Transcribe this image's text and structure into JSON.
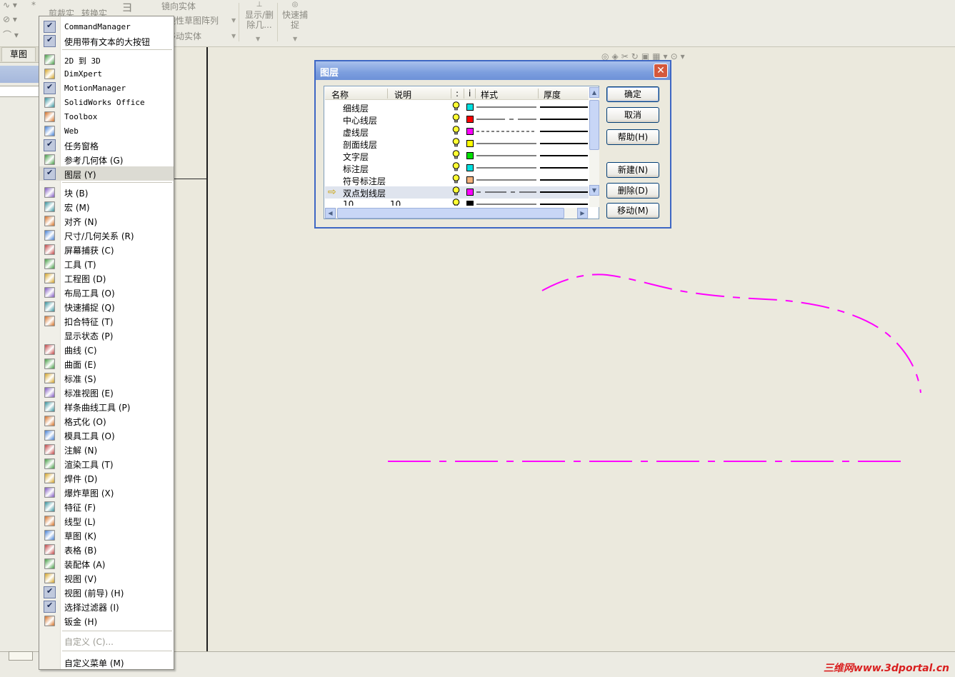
{
  "toolbar": {
    "trim": "剪裁实",
    "convert": "转换实",
    "mirror": "镜向实体",
    "linear_pattern": "线性草图阵列",
    "move": "移动实体",
    "show_delete_line1": "显示/删",
    "show_delete_line2": "除几...",
    "quick_snap_line1": "快速捕",
    "quick_snap_line2": "捉",
    "sketch_tab": "草图"
  },
  "context_menu": {
    "items": [
      {
        "label": "CommandManager",
        "checked": true,
        "mono": true
      },
      {
        "label": "使用带有文本的大按钮",
        "checked": true
      },
      {
        "label": "2D 到 3D",
        "icon": "2d-to-3d-icon",
        "mono": true
      },
      {
        "label": "DimXpert",
        "icon": "dimxpert-icon",
        "mono": true
      },
      {
        "label": "MotionManager",
        "checked": true,
        "mono": true
      },
      {
        "label": "SolidWorks Office",
        "icon": "solidworks-office-icon",
        "mono": true
      },
      {
        "label": "Toolbox",
        "icon": "toolbox-icon",
        "mono": true
      },
      {
        "label": "Web",
        "icon": "web-globe-icon",
        "mono": true
      },
      {
        "label": "任务窗格",
        "checked": true
      },
      {
        "label": "参考几何体 (G)",
        "icon": "reference-geometry-icon"
      },
      {
        "label": "图层 (Y)",
        "checked": true,
        "highlighted": true
      },
      {
        "label": "块 (B)",
        "icon": "block-icon"
      },
      {
        "label": "宏 (M)",
        "icon": "macro-icon"
      },
      {
        "label": "对齐 (N)",
        "icon": "align-icon"
      },
      {
        "label": "尺寸/几何关系 (R)",
        "icon": "dimensions-relations-icon"
      },
      {
        "label": "屏幕捕获 (C)",
        "icon": "screen-capture-icon"
      },
      {
        "label": "工具 (T)",
        "icon": "tools-icon"
      },
      {
        "label": "工程图 (D)",
        "icon": "drawing-icon"
      },
      {
        "label": "布局工具 (O)",
        "icon": "layout-tools-icon"
      },
      {
        "label": "快速捕捉 (Q)",
        "icon": "quick-snap-icon"
      },
      {
        "label": "扣合特征 (T)",
        "icon": "fastening-feature-icon"
      },
      {
        "label": "显示状态 (P)",
        "icon": ""
      },
      {
        "label": "曲线 (C)",
        "icon": "curves-icon"
      },
      {
        "label": "曲面 (E)",
        "icon": "surfaces-icon"
      },
      {
        "label": "标准 (S)",
        "icon": "standard-icon"
      },
      {
        "label": "标准视图 (E)",
        "icon": "standard-views-icon"
      },
      {
        "label": "样条曲线工具 (P)",
        "icon": "spline-tools-icon"
      },
      {
        "label": "格式化 (O)",
        "icon": "format-icon"
      },
      {
        "label": "模具工具 (O)",
        "icon": "mold-tools-icon"
      },
      {
        "label": "注解 (N)",
        "icon": "annotation-icon"
      },
      {
        "label": "渲染工具 (T)",
        "icon": "render-tools-icon"
      },
      {
        "label": "焊件 (D)",
        "icon": "weldments-icon"
      },
      {
        "label": "爆炸草图 (X)",
        "icon": "explode-sketch-icon"
      },
      {
        "label": "特征 (F)",
        "icon": "features-icon"
      },
      {
        "label": "线型 (L)",
        "icon": "line-format-icon"
      },
      {
        "label": "草图 (K)",
        "icon": "sketch-icon"
      },
      {
        "label": "表格 (B)",
        "icon": "table-icon"
      },
      {
        "label": "装配体 (A)",
        "icon": "assembly-icon"
      },
      {
        "label": "视图 (V)",
        "icon": "view-icon"
      },
      {
        "label": "视图 (前导) (H)",
        "checked": true
      },
      {
        "label": "选择过滤器 (I)",
        "checked": true,
        "icon": "selection-filter-icon"
      },
      {
        "label": "钣金 (H)",
        "icon": "sheet-metal-icon"
      }
    ],
    "customize": "自定义 (C)...",
    "customize_menu": "自定义菜单 (M)"
  },
  "layer_dialog": {
    "title": "图层",
    "columns": {
      "name": "名称",
      "description": "说明",
      "on": ":",
      "info": "i",
      "style": "样式",
      "thickness": "厚度"
    },
    "rows": [
      {
        "name": "细线层",
        "color": "#00e0e0",
        "style": "solid"
      },
      {
        "name": "中心线层",
        "color": "#ff0000",
        "style": "center"
      },
      {
        "name": "虚线层",
        "color": "#ff00ff",
        "style": "dashed"
      },
      {
        "name": "剖面线层",
        "color": "#ffff00",
        "style": "solid"
      },
      {
        "name": "文字层",
        "color": "#00e000",
        "style": "solid"
      },
      {
        "name": "标注层",
        "color": "#00e0e0",
        "style": "solid"
      },
      {
        "name": "符号标注层",
        "color": "#f5b27c",
        "style": "solid"
      },
      {
        "name": "双点划线层",
        "color": "#ff00ff",
        "style": "phantom",
        "current": true
      },
      {
        "name": "10",
        "description": "10",
        "color": "#000000",
        "style": "solid"
      }
    ],
    "buttons": {
      "ok": "确定",
      "cancel": "取消",
      "help": "帮助(H)",
      "new": "新建(N)",
      "delete": "删除(D)",
      "move": "移动(M)"
    }
  },
  "watermark": "三维网www.3dportal.cn",
  "colors": {
    "sketch_line": "#ff00ff",
    "title_bar": "#7c9ede"
  }
}
